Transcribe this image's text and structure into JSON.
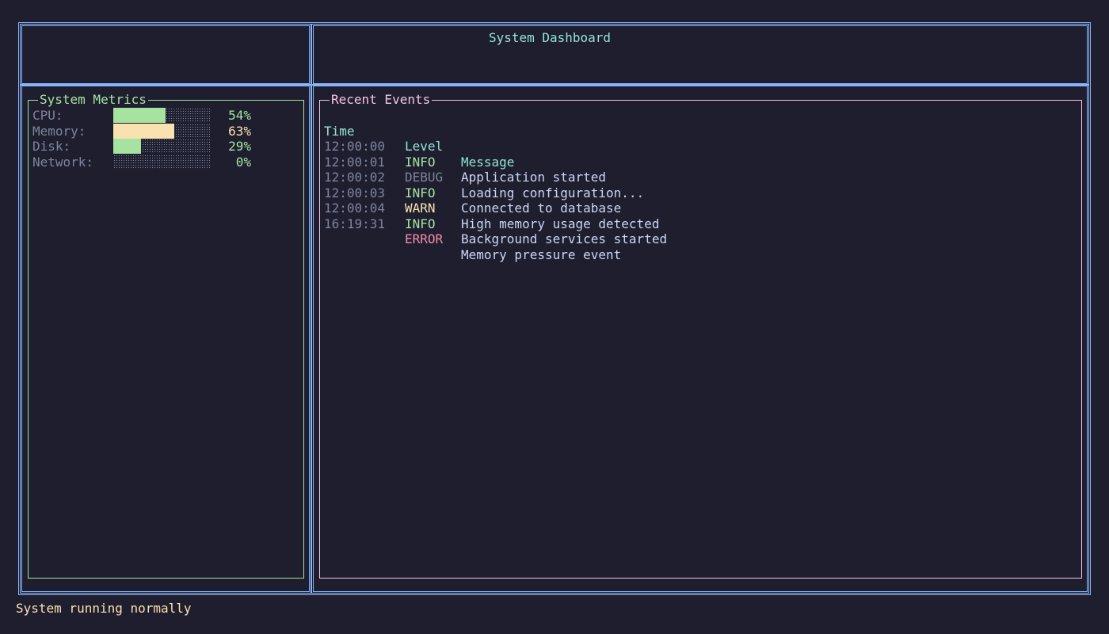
{
  "header": {
    "title": "System Dashboard"
  },
  "metrics": {
    "title": "System Metrics",
    "items": [
      {
        "label": "CPU:",
        "value": "54%",
        "fraction": 0.54,
        "color": "#a6e3a1"
      },
      {
        "label": "Memory:",
        "value": "63%",
        "fraction": 0.63,
        "color": "#f9e2af"
      },
      {
        "label": "Disk:",
        "value": "29%",
        "fraction": 0.29,
        "color": "#a6e3a1"
      },
      {
        "label": "Network:",
        "value": "0%",
        "fraction": 0.0,
        "color": "#a6e3a1"
      }
    ]
  },
  "events": {
    "title": "Recent Events",
    "columns": {
      "time": "Time",
      "level": "Level",
      "message": "Message"
    },
    "rows": [
      {
        "time": "12:00:00",
        "level": "INFO",
        "message": "Application started",
        "level_color": "#a6e3a1"
      },
      {
        "time": "12:00:01",
        "level": "DEBUG",
        "message": "Loading configuration...",
        "level_color": "#7f849c"
      },
      {
        "time": "12:00:02",
        "level": "INFO",
        "message": "Connected to database",
        "level_color": "#a6e3a1"
      },
      {
        "time": "12:00:03",
        "level": "WARN",
        "message": "High memory usage detected",
        "level_color": "#f9e2af"
      },
      {
        "time": "12:00:04",
        "level": "INFO",
        "message": "Background services started",
        "level_color": "#a6e3a1"
      },
      {
        "time": "16:19:31",
        "level": "ERROR",
        "message": "Memory pressure event",
        "level_color": "#f38ba8"
      }
    ]
  },
  "status": {
    "text": "System running normally"
  },
  "colors": {
    "background": "#1e1e2e",
    "border": "#89b4fa",
    "accent": "#94e2d5",
    "metrics_border": "#a6e3a1",
    "events_border": "#f5c2e7"
  }
}
